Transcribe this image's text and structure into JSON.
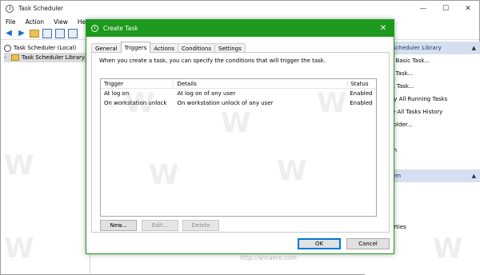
{
  "app": {
    "title": "Task Scheduler",
    "window_controls": {
      "minimize": "—",
      "maximize": "☐",
      "close": "✕"
    }
  },
  "menu": [
    "File",
    "Action",
    "View",
    "Help"
  ],
  "tree": {
    "root": "Task Scheduler (Local)",
    "library": "Task Scheduler Library"
  },
  "actions_pane": {
    "section1_header": "Scheduler Library",
    "items": [
      "e Basic Task...",
      "e Task...",
      "rt Task...",
      "ay All Running Tasks",
      "le All Tasks History",
      "Folder..."
    ],
    "item_after_gap": "sh",
    "section2_header": "em",
    "section2_items": [
      "e",
      "t",
      "",
      "erties"
    ]
  },
  "watermark": {
    "glyph": "W",
    "text": "http://winaero.com"
  },
  "dialog": {
    "title": "Create Task",
    "close": "✕",
    "tabs": [
      "General",
      "Triggers",
      "Actions",
      "Conditions",
      "Settings"
    ],
    "active_tab": "Triggers",
    "description": "When you create a task, you can specify the conditions that will trigger the task.",
    "table": {
      "headers": [
        "Trigger",
        "Details",
        "Status"
      ],
      "rows": [
        [
          "At log on",
          "At log on of any user",
          "Enabled"
        ],
        [
          "On workstation unlock",
          "On workstation unlock of any user",
          "Enabled"
        ]
      ]
    },
    "buttons": {
      "new": "New...",
      "edit": "Edit...",
      "delete": "Delete",
      "ok": "OK",
      "cancel": "Cancel"
    }
  },
  "colors": {
    "dialog_accent": "#1d9a1d",
    "actions_header": "#d6dff0"
  }
}
